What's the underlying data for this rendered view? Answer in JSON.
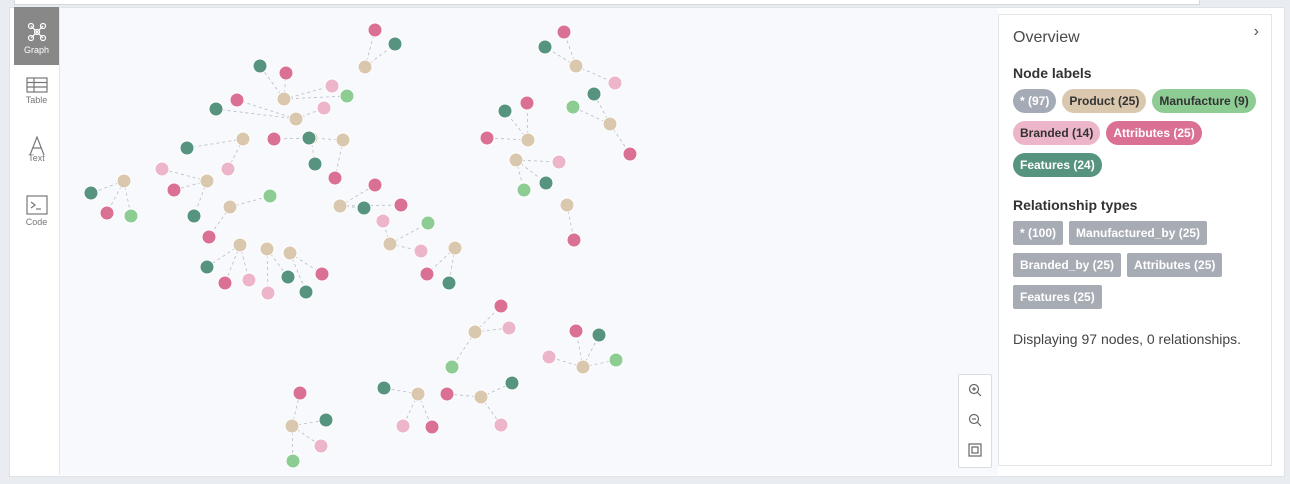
{
  "sidebar": {
    "items": [
      {
        "label": "Graph",
        "icon": "graph-icon",
        "active": true
      },
      {
        "label": "Table",
        "icon": "table-icon",
        "active": false
      },
      {
        "label": "Text",
        "icon": "text-icon",
        "active": false
      },
      {
        "label": "Code",
        "icon": "code-icon",
        "active": false
      }
    ]
  },
  "panel": {
    "title": "Overview",
    "node_labels_title": "Node labels",
    "node_labels": [
      {
        "label": "* (97)",
        "bg": "#a5abb6",
        "fg": "#ffffff"
      },
      {
        "label": "Product (25)",
        "bg": "#d9c8ae",
        "fg": "#333333"
      },
      {
        "label": "Manufacture (9)",
        "bg": "#8dcc93",
        "fg": "#333333"
      },
      {
        "label": "Branded (14)",
        "bg": "#ecb5c9",
        "fg": "#333333"
      },
      {
        "label": "Attributes (25)",
        "bg": "#da7194",
        "fg": "#ffffff"
      },
      {
        "label": "Features (24)",
        "bg": "#569480",
        "fg": "#ffffff"
      }
    ],
    "rel_types_title": "Relationship types",
    "rel_types": [
      "* (100)",
      "Manufactured_by (25)",
      "Branded_by (25)",
      "Attributes (25)",
      "Features (25)"
    ],
    "status": "Displaying 97 nodes, 0 relationships."
  },
  "colors": {
    "product": "#d9c8ae",
    "manufacture": "#8dcc93",
    "branded": "#ecb5c9",
    "attributes": "#da7194",
    "features": "#569480"
  }
}
